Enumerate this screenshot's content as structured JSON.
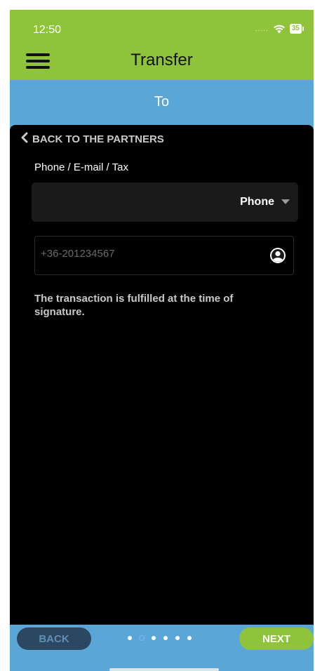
{
  "status_bar": {
    "time": "12:50",
    "signal": ".....",
    "battery": "35"
  },
  "header": {
    "title": "Transfer",
    "menu_icon": "hamburger-icon"
  },
  "step": {
    "title": "To"
  },
  "form": {
    "back_link_label": "BACK TO THE PARTNERS",
    "field_label": "Phone / E-mail / Tax",
    "select_value": "Phone",
    "phone_placeholder": "+36-201234567",
    "info_text": "The transaction is fulfilled at the time of signature."
  },
  "footer": {
    "back_label": "BACK",
    "next_label": "NEXT",
    "dots": [
      {
        "state": "done"
      },
      {
        "state": "current"
      },
      {
        "state": "todo"
      },
      {
        "state": "todo"
      },
      {
        "state": "todo"
      },
      {
        "state": "todo"
      }
    ]
  },
  "colors": {
    "brand_green": "#8fc43a",
    "band_blue": "#5aa6d6",
    "panel_black": "#000000",
    "back_button_bg": "#2c4860"
  }
}
